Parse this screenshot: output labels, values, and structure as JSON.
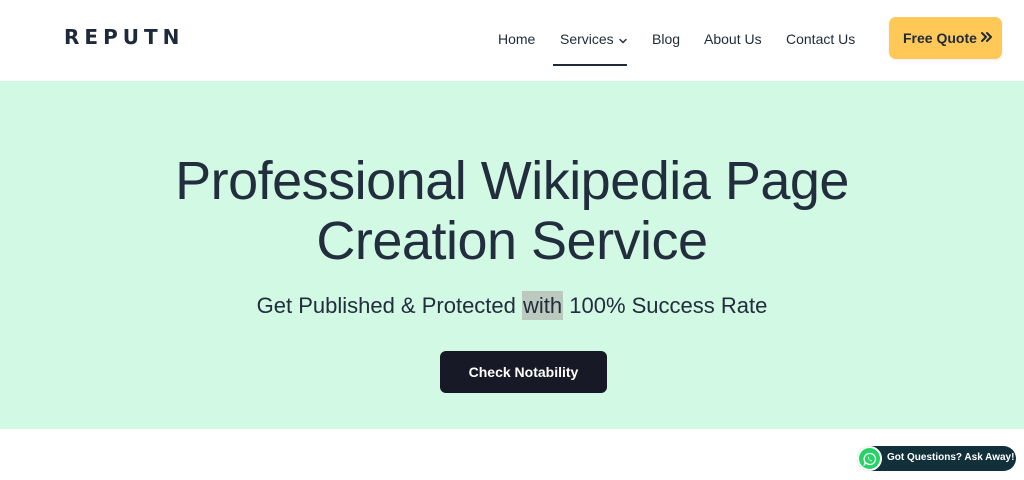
{
  "brand": {
    "logo_text": "REPUTN"
  },
  "nav": {
    "items": [
      {
        "label": "Home"
      },
      {
        "label": "Services"
      },
      {
        "label": "Blog"
      },
      {
        "label": "About Us"
      },
      {
        "label": "Contact Us"
      }
    ],
    "active_item": "Services",
    "quote_button": "Free Quote"
  },
  "hero": {
    "title_line1": "Professional Wikipedia Page",
    "title_line2": "Creation Service",
    "subtitle_before": "Get Published & Protected ",
    "subtitle_highlight": "with",
    "subtitle_after": " 100% Success Rate",
    "cta_label": "Check Notability"
  },
  "chat": {
    "label": "Got Questions? Ask Away!"
  },
  "colors": {
    "hero_bg": "#d1f9e3",
    "accent": "#ffc857",
    "dark": "#171a26",
    "whatsapp": "#25d366"
  }
}
